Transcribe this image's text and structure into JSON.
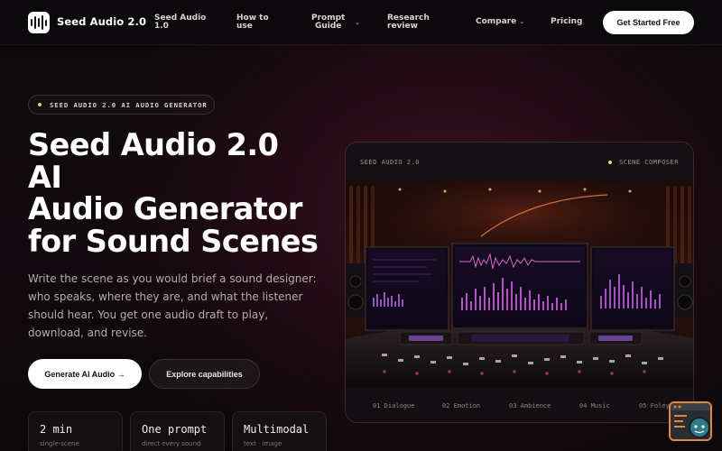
{
  "brand": {
    "name": "Seed Audio 2.0"
  },
  "nav": {
    "items": [
      {
        "label_line1": "Seed Audio",
        "label_line2": "1.0",
        "has_dropdown": false
      },
      {
        "label_line1": "How to",
        "label_line2": "use",
        "has_dropdown": false
      },
      {
        "label_line1": "Prompt",
        "label_line2": "Guide",
        "has_dropdown": true
      },
      {
        "label_line1": "Research",
        "label_line2": "review",
        "has_dropdown": false
      },
      {
        "label_line1": "Compare",
        "label_line2": "",
        "has_dropdown": true
      },
      {
        "label_line1": "Pricing",
        "label_line2": "",
        "has_dropdown": false
      }
    ],
    "cta": "Get Started Free"
  },
  "hero": {
    "eyebrow": "SEED AUDIO 2.0 AI AUDIO GENERATOR",
    "title_lines": [
      "Seed Audio 2.0",
      "AI",
      "Audio Generator",
      "for Sound Scenes"
    ],
    "lede": "Write the scene as you would brief a sound designer: who speaks, where they are, and what the listener should hear. You get one audio draft to play, download, and revise.",
    "primary_button": "Generate AI Audio →",
    "secondary_button": "Explore capabilities",
    "stats": [
      {
        "value": "2 min",
        "sub": "single-scene"
      },
      {
        "value": "One prompt",
        "sub": "direct every sound"
      },
      {
        "value": "Multimodal",
        "sub": "text · image"
      }
    ]
  },
  "scene_card": {
    "title": "SEED AUDIO 2.0",
    "badge": "SCENE COMPOSER",
    "tabs": [
      "01 Dialogue",
      "02 Emotion",
      "03 Ambience",
      "04 Music",
      "05 Foley"
    ]
  },
  "colors": {
    "accent_dot": "#c7e26b",
    "badge_dot": "#e3e36b",
    "widget_border": "#e0893b"
  },
  "icons": {
    "logo": "waveform-icon",
    "dropdown": "chevron-down-icon",
    "widget": "chat-widget-icon"
  }
}
